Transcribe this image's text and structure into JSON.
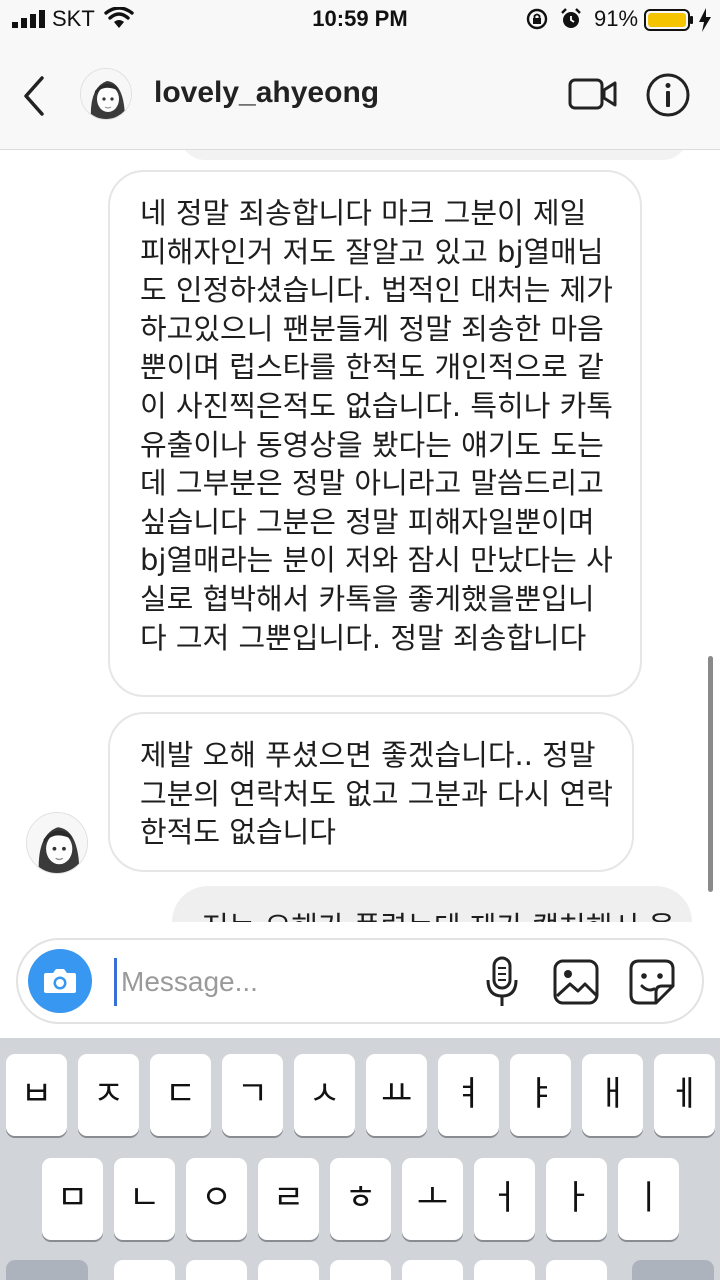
{
  "status_bar": {
    "carrier": "SKT",
    "time": "10:59 PM",
    "battery": "91%",
    "icons": [
      "signal-icon",
      "wifi-icon",
      "orientation-lock-icon",
      "alarm-icon",
      "battery-icon",
      "charging-icon"
    ],
    "battery_color": "#f5c400"
  },
  "header": {
    "username": "lovely_ahyeong",
    "icons": [
      "back-chevron-icon",
      "avatar",
      "video-camera-icon",
      "info-icon"
    ]
  },
  "messages": [
    {
      "id": "msg-1",
      "lines": [
        "네 정말 죄송합니다 마크 그분이 제일",
        "피해자인거 저도 잘알고 있고 bj열매님",
        "도 인정하셨습니다. 법적인 대처는 제가",
        "하고있으니 팬분들게 정말 죄송한 마음",
        "뿐이며 럽스타를 한적도 개인적으로 같",
        "이 사진찍은적도 없습니다. 특히나 카톡",
        "유출이나 동영상을 봤다는 얘기도 도는",
        "데 그부분은 정말 아니라고 말씀드리고",
        "싶습니다 그분은 정말 피해자일뿐이며",
        "bj열매라는 분이 저와 잠시 만났다는 사",
        "실로 협박해서 카톡을 좋게했을뿐입니",
        "다 그저 그뿐입니다. 정말 죄송합니다"
      ]
    },
    {
      "id": "msg-2",
      "lines": [
        "제발 오해 푸셨으면 좋겠습니다.. 정말",
        "그분의 연락처도 없고 그분과 다시 연락",
        "한적도 없습니다"
      ]
    },
    {
      "id": "msg-3",
      "lines": [
        "저는 오해가 풀렸는데 제가 캡처해서 올"
      ]
    }
  ],
  "composer": {
    "placeholder": "Message...",
    "accent": "#3897f0",
    "icons": [
      "camera-icon",
      "microphone-icon",
      "gallery-icon",
      "sticker-icon"
    ]
  },
  "keyboard": {
    "row1": [
      "ㅂ",
      "ㅈ",
      "ㄷ",
      "ㄱ",
      "ㅅ",
      "ㅛ",
      "ㅕ",
      "ㅑ",
      "ㅐ",
      "ㅔ"
    ],
    "row2": [
      "ㅁ",
      "ㄴ",
      "ㅇ",
      "ㄹ",
      "ㅎ",
      "ㅗ",
      "ㅓ",
      "ㅏ",
      "ㅣ"
    ]
  }
}
